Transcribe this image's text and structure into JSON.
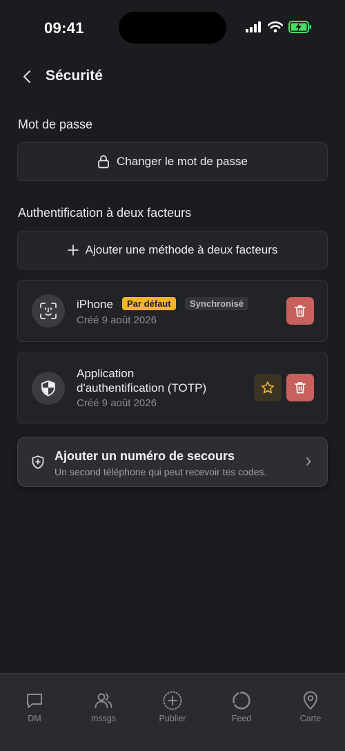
{
  "status_bar": {
    "time": "09:41"
  },
  "header": {
    "title": "Sécurité"
  },
  "password_section": {
    "title": "Mot de passe",
    "change_button_label": "Changer le mot de passe"
  },
  "twofa_section": {
    "title": "Authentification à deux facteurs",
    "add_button_label": "Ajouter une méthode à deux facteurs",
    "methods": [
      {
        "name": "iPhone",
        "badge_default": "Par défaut",
        "badge_sync": "Synchronisé",
        "created": "Créé 9 août 2026",
        "icon": "face-id-icon"
      },
      {
        "name_line1": "Application",
        "name_line2": "d'authentification (TOTP)",
        "created": "Créé 9 août 2026",
        "icon": "shield-icon"
      }
    ]
  },
  "backup": {
    "title": "Ajouter un numéro de secours",
    "subtitle": "Un second téléphone qui peut recevoir tes codes."
  },
  "tabs": [
    {
      "label": "DM",
      "icon": "chat-bubble-icon"
    },
    {
      "label": "mssgs",
      "icon": "users-icon"
    },
    {
      "label": "Publier",
      "icon": "plus-circle-icon"
    },
    {
      "label": "Feed",
      "icon": "circle-icon"
    },
    {
      "label": "Carte",
      "icon": "map-pin-icon"
    }
  ],
  "colors": {
    "background": "#1b1c1f",
    "card": "#222326",
    "default_badge": "#f3b629",
    "delete": "#c8605e"
  }
}
